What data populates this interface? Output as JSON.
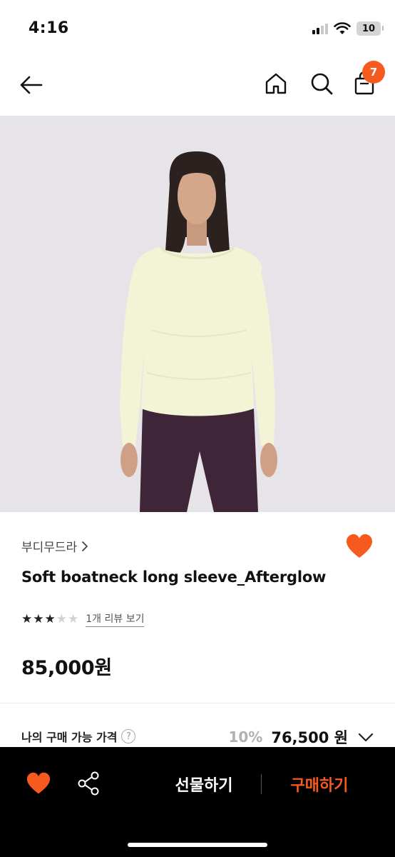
{
  "status_bar": {
    "time": "4:16",
    "battery": "10"
  },
  "header": {
    "cart_count": "7"
  },
  "product": {
    "brand": "부디무드라",
    "title": "Soft boatneck long sleeve_Afterglow",
    "rating": 3,
    "rating_max": 5,
    "review_link": "1개 리뷰 보기",
    "price": "85,000원"
  },
  "my_price": {
    "label": "나의 구매 가능 가격",
    "discount": "10%",
    "price": "76,500 원"
  },
  "bottom_bar": {
    "gift_label": "선물하기",
    "buy_label": "구매하기"
  },
  "colors": {
    "accent": "#f65a1e",
    "image_bg": "#e7e4e9",
    "top": "#f3f4d6",
    "pants": "#3e2538"
  }
}
